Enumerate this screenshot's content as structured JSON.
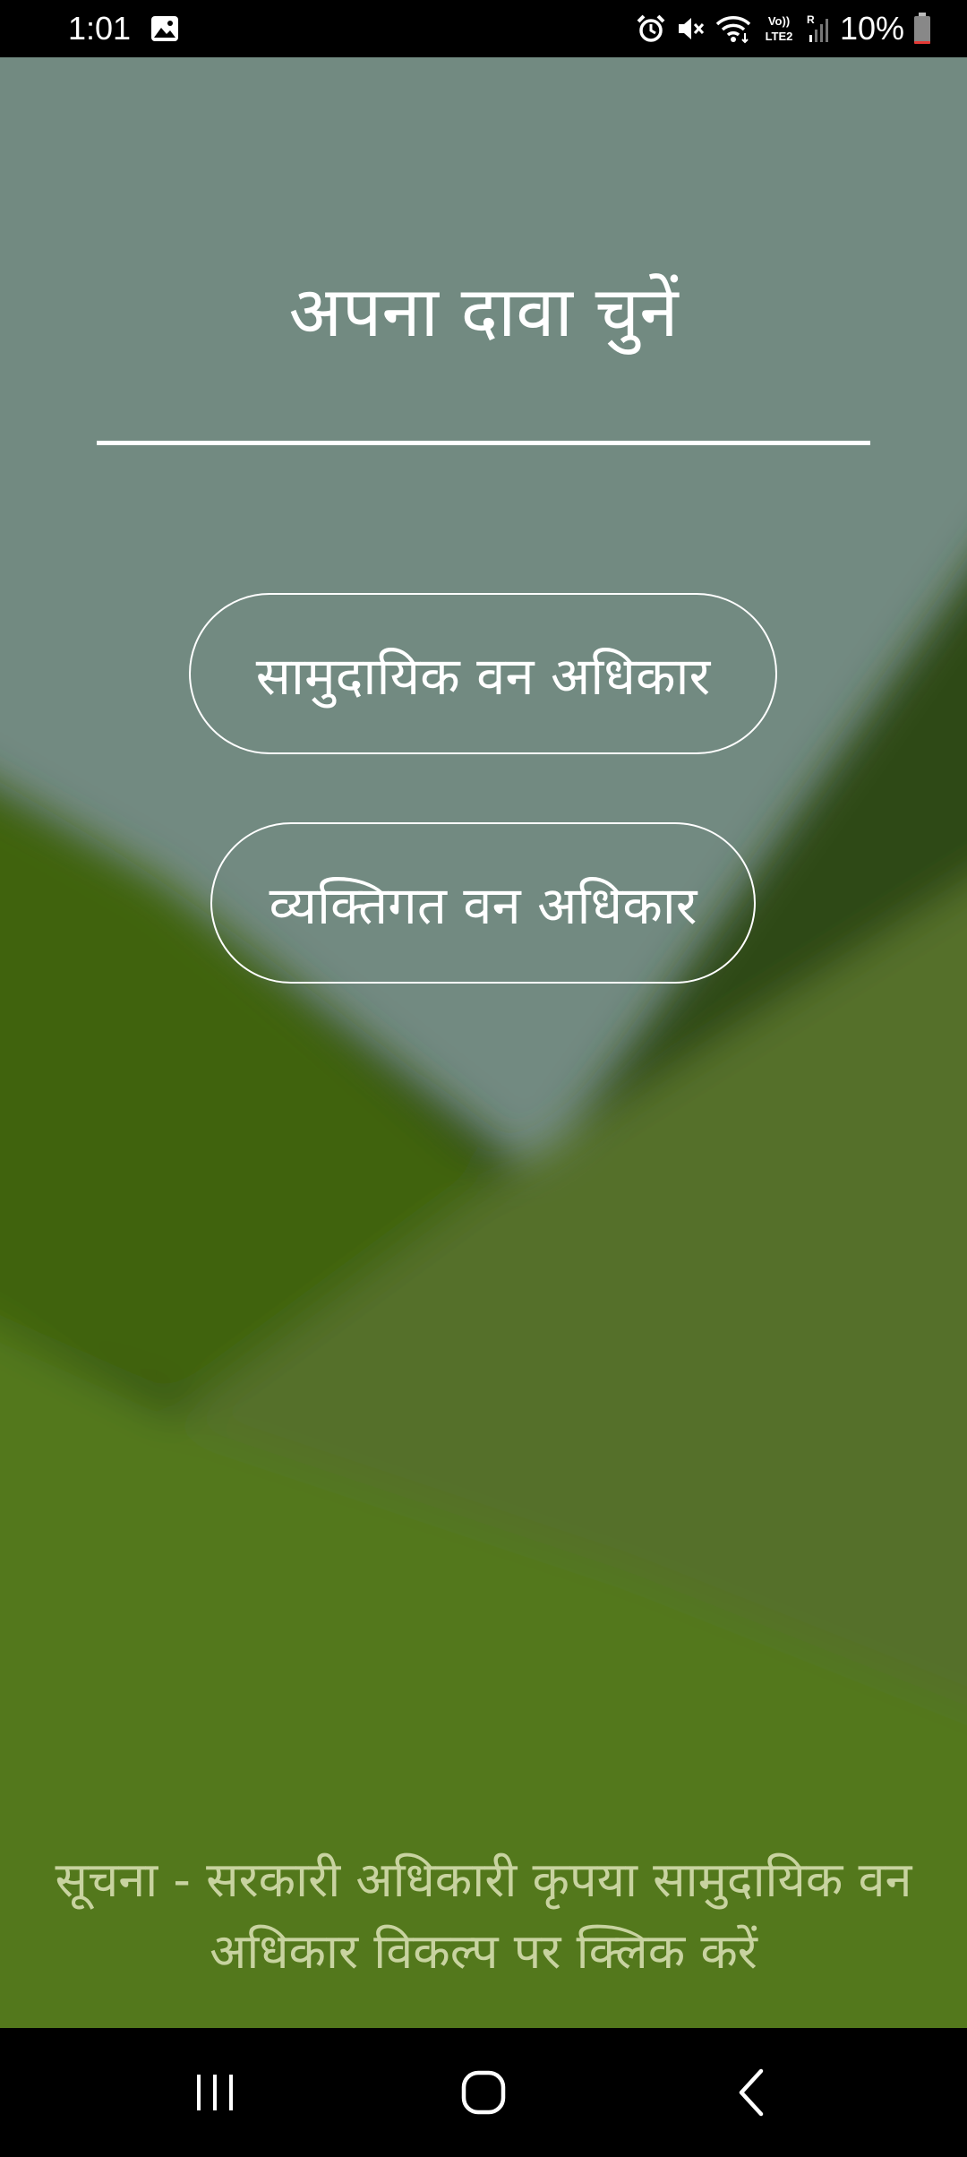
{
  "status_bar": {
    "time": "1:01",
    "icons": [
      "gallery-icon",
      "alarm-icon",
      "mute-icon",
      "wifi-icon",
      "volte-icon",
      "signal-icon"
    ],
    "network_label_top": "Vo))",
    "network_label_bottom": "LTE2",
    "roaming_label": "R",
    "battery_percent": "10%",
    "battery_level": 0.1,
    "battery_color": "#e53935"
  },
  "main": {
    "title": "अपना दावा चुनें",
    "buttons": {
      "community": "सामुदायिक वन अधिकार",
      "individual": "व्यक्तिगत वन अधिकार"
    },
    "notice": "सूचना - सरकारी अधिकारी कृपया सामुदायिक वन अधिकार विकल्प पर क्लिक करें"
  },
  "nav_bar": {
    "icons": [
      "recents-icon",
      "home-icon",
      "back-icon"
    ]
  },
  "colors": {
    "sky": "#728a81",
    "dark_hill": "#2f4a14",
    "mid_hill": "#3f6410",
    "light_hill": "#54702c",
    "ground": "#53781f",
    "notice_text": "#c8d3a0"
  }
}
